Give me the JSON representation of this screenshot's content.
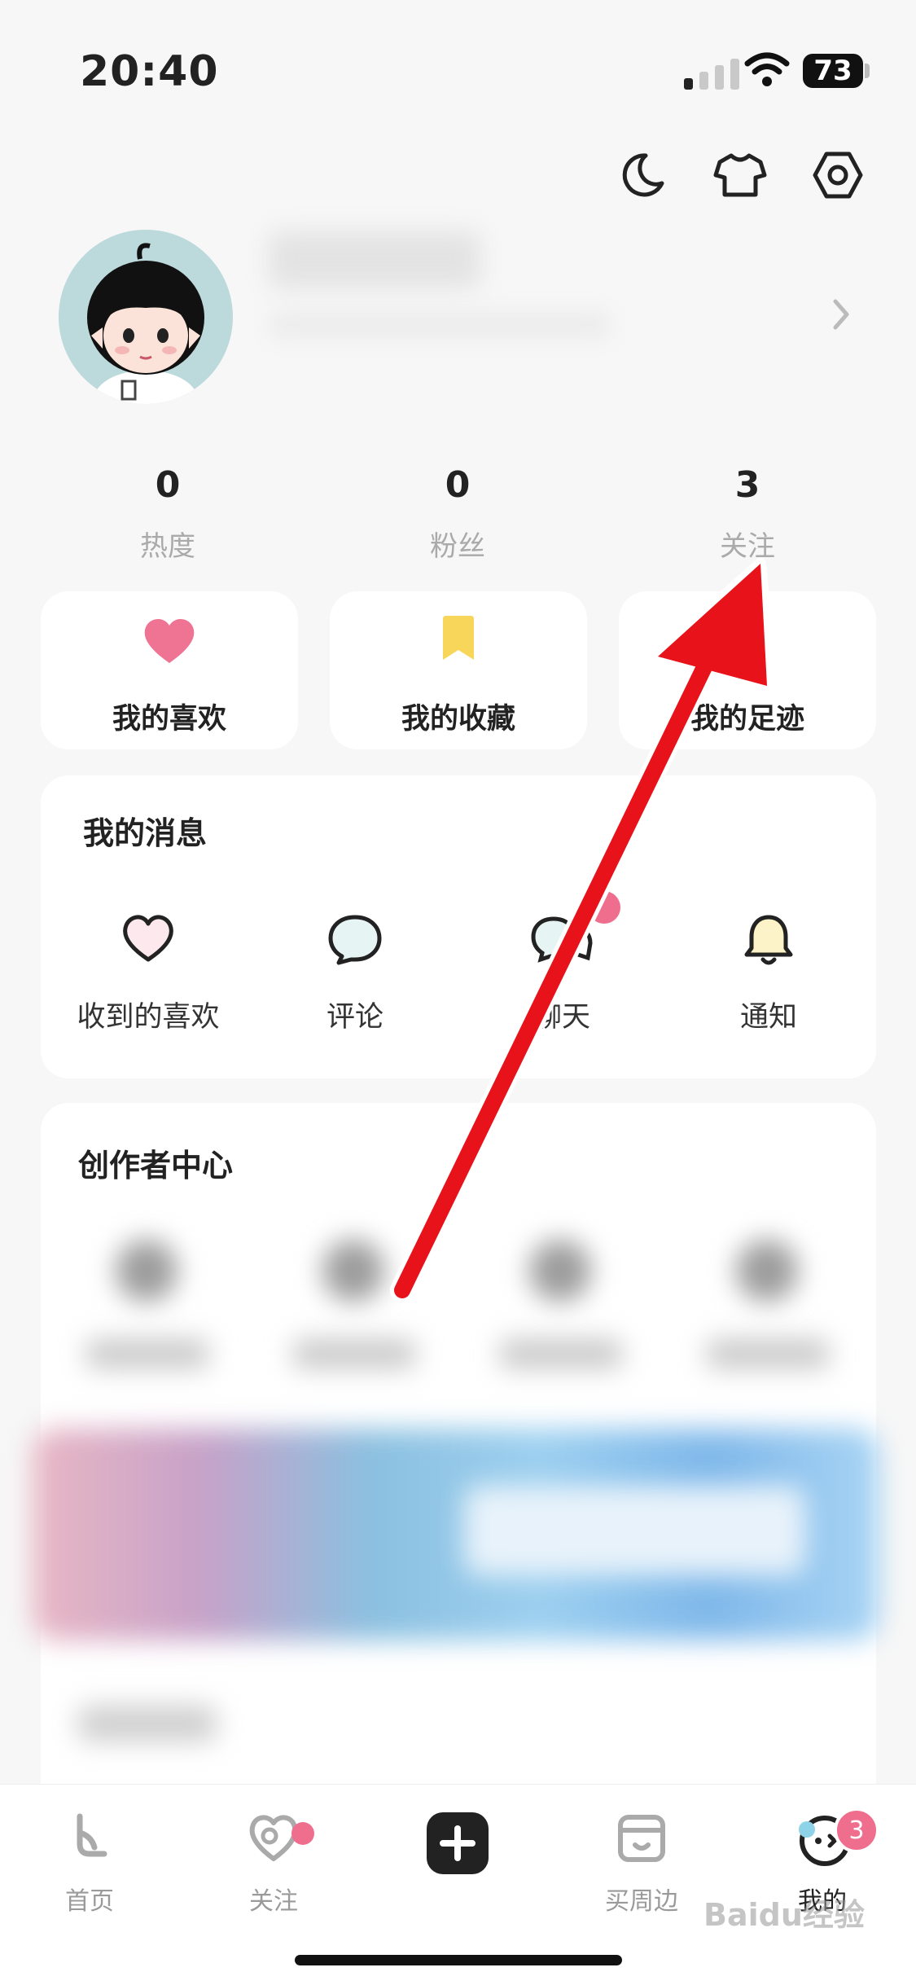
{
  "status_bar": {
    "time": "20:40",
    "battery": "73"
  },
  "stats": [
    {
      "value": "0",
      "label": "热度"
    },
    {
      "value": "0",
      "label": "粉丝"
    },
    {
      "value": "3",
      "label": "关注"
    }
  ],
  "quick_actions": [
    {
      "label": "我的喜欢",
      "icon": "heart-icon",
      "color": "#ef7392"
    },
    {
      "label": "我的收藏",
      "icon": "bookmark-icon",
      "color": "#f8d65a"
    },
    {
      "label": "我的足迹",
      "icon": "footprint-icon",
      "color": "#5fb7ef"
    }
  ],
  "messages": {
    "title": "我的消息",
    "items": [
      {
        "label": "收到的喜欢",
        "icon": "heart-outline-icon"
      },
      {
        "label": "评论",
        "icon": "comment-icon"
      },
      {
        "label": "聊天",
        "icon": "chat-icon"
      },
      {
        "label": "通知",
        "icon": "bell-icon"
      }
    ]
  },
  "creator": {
    "title": "创作者中心"
  },
  "tabbar": {
    "items": [
      {
        "label": "首页",
        "icon": "home-icon"
      },
      {
        "label": "关注",
        "icon": "follow-icon"
      },
      {
        "label": "",
        "icon": "plus-icon"
      },
      {
        "label": "买周边",
        "icon": "shop-icon"
      },
      {
        "label": "我的",
        "icon": "me-icon"
      }
    ],
    "me_badge": "3"
  },
  "watermark": "Baidu经验",
  "colors": {
    "accent_pink": "#ef6e8e",
    "annotation_red": "#e8121a"
  }
}
